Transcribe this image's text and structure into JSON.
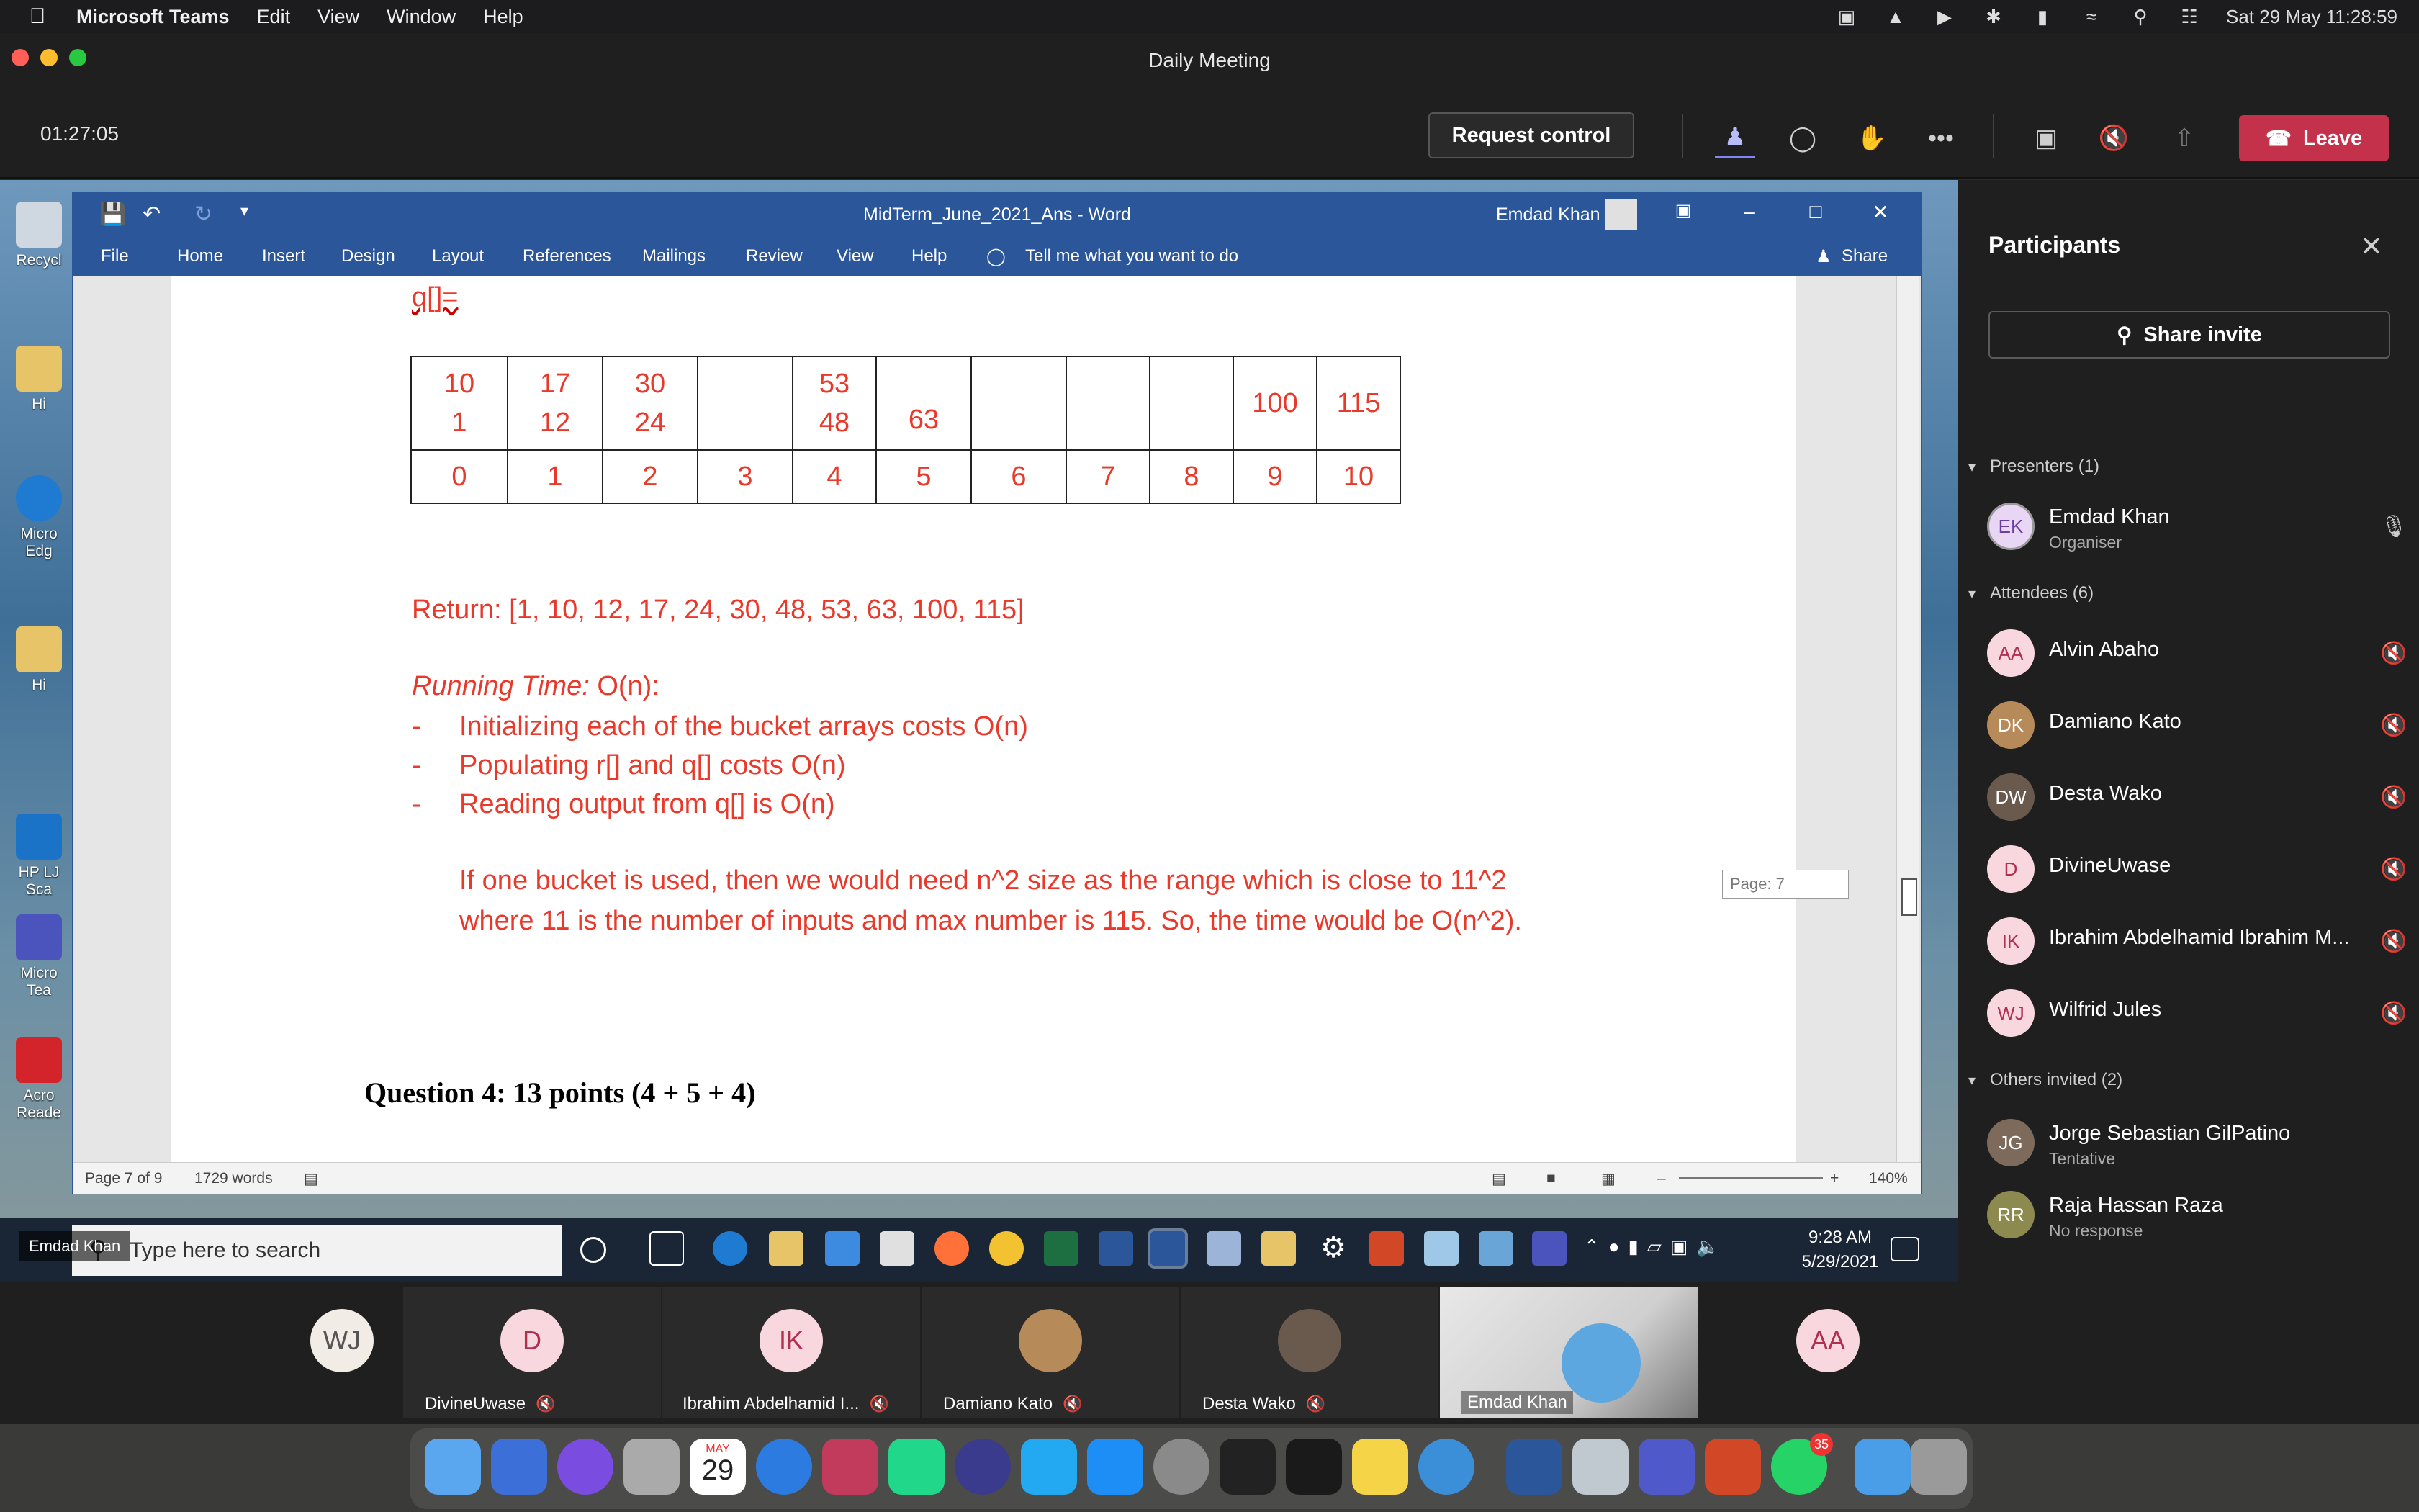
{
  "menubar": {
    "app_name": "Microsoft Teams",
    "items": [
      "Edit",
      "View",
      "Window",
      "Help"
    ],
    "clock": "Sat 29 May  11:28:59"
  },
  "window": {
    "title": "Daily Meeting"
  },
  "meeting": {
    "timer": "01:27:05",
    "request_control": "Request control",
    "leave": "Leave"
  },
  "word": {
    "doc_title": "MidTerm_June_2021_Ans  -  Word",
    "user": "Emdad Khan",
    "tabs": [
      "File",
      "Home",
      "Insert",
      "Design",
      "Layout",
      "References",
      "Mailings",
      "Review",
      "View",
      "Help"
    ],
    "tell_me": "Tell me what you want to do",
    "share": "Share",
    "page_tooltip": "Page: 7",
    "status": {
      "page": "Page 7 of 9",
      "words": "1729 words",
      "zoom": "140%"
    }
  },
  "document": {
    "q_label": "q[]=",
    "table_top": [
      "10\n1",
      "17\n12",
      "30\n24",
      "",
      "53\n48",
      "63",
      "",
      "",
      "",
      "100",
      "115"
    ],
    "table_idx": [
      "0",
      "1",
      "2",
      "3",
      "4",
      "5",
      "6",
      "7",
      "8",
      "9",
      "10"
    ],
    "return_line": "Return: [1, 10, 12, 17, 24, 30, 48, 53, 63, 100, 115]",
    "running_time_label": "Running Time:",
    "running_time_value": " O(n):",
    "bullets": [
      "Initializing each of the bucket arrays costs O(n)",
      "Populating r[] and q[] costs O(n)",
      "Reading output from q[] is O(n)"
    ],
    "para1": "If one bucket is used, then we would need n^2 size as the range which is close to 11^2",
    "para2": "where 11 is the number of inputs and max number is 115. So, the time would be O(n^2).",
    "question4": "Question 4:  13 points  (4 + 5 + 4)"
  },
  "desktop_icons": [
    "Recycl",
    "Hi",
    "Micro Edg",
    "Hi",
    "HP LJ Sca",
    "Micro Tea",
    "Acro Reade"
  ],
  "win_taskbar": {
    "search_placeholder": "Type here to search",
    "time": "9:28 AM",
    "date": "5/29/2021"
  },
  "share_label": "Emdad Khan",
  "panel": {
    "title": "Participants",
    "share_invite": "Share invite",
    "presenters_header": "Presenters (1)",
    "attendees_header": "Attendees (6)",
    "others_header": "Others invited (2)",
    "presenters": [
      {
        "initials": "EK",
        "name": "Emdad Khan",
        "role": "Organiser"
      }
    ],
    "attendees": [
      {
        "initials": "AA",
        "name": "Alvin Abaho"
      },
      {
        "initials": "DK",
        "name": "Damiano Kato"
      },
      {
        "initials": "DW",
        "name": "Desta Wako"
      },
      {
        "initials": "D",
        "name": "DivineUwase"
      },
      {
        "initials": "IK",
        "name": "Ibrahim Abdelhamid Ibrahim M..."
      },
      {
        "initials": "WJ",
        "name": "Wilfrid Jules"
      }
    ],
    "others": [
      {
        "initials": "JG",
        "name": "Jorge Sebastian GilPatino",
        "role": "Tentative"
      },
      {
        "initials": "RR",
        "name": "Raja Hassan Raza",
        "role": "No response"
      }
    ]
  },
  "gallery": [
    {
      "initials": "WJ",
      "name": ""
    },
    {
      "initials": "D",
      "name": "DivineUwase"
    },
    {
      "initials": "IK",
      "name": "Ibrahim Abdelhamid I..."
    },
    {
      "initials": "",
      "name": "Damiano Kato"
    },
    {
      "initials": "",
      "name": "Desta Wako"
    },
    {
      "initials": "",
      "name": "Emdad Khan"
    },
    {
      "initials": "AA",
      "name": ""
    }
  ],
  "dock": {
    "calendar_month": "MAY",
    "calendar_day": "29",
    "whatsapp_badge": "35"
  },
  "colors": {
    "leave": "#c4314b",
    "word_blue": "#2b579a",
    "doc_text": "#e8392b",
    "accent": "#7f85f5"
  }
}
